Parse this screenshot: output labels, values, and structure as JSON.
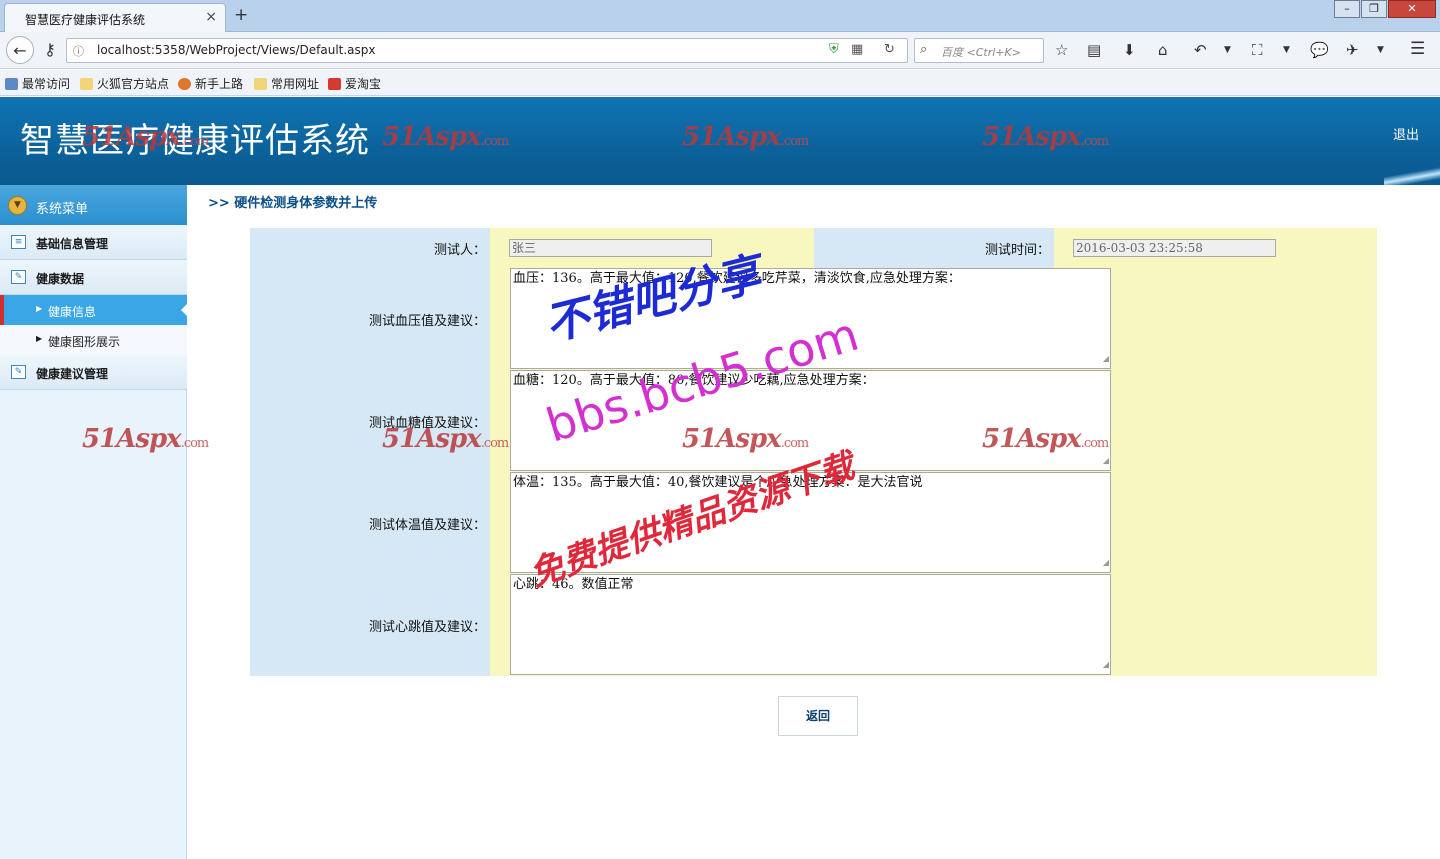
{
  "browser": {
    "tab_title": "智慧医疗健康评估系统",
    "tab_close": "×",
    "new_tab": "+",
    "url": "localhost:5358/WebProject/Views/Default.aspx",
    "search_placeholder": "百度 <Ctrl+K>",
    "bookmarks": [
      "最常访问",
      "火狐官方站点",
      "新手上路",
      "常用网址",
      "爱淘宝"
    ]
  },
  "header": {
    "title": "智慧医疗健康评估系统",
    "logout": "退出"
  },
  "watermark": {
    "brand": "51Aspx",
    "suffix": ".com",
    "forum_line1": "不错吧分享",
    "forum_line2": "bbs.bcb5.com",
    "forum_line3": "免费提供精品资源下载"
  },
  "sidebar": {
    "head": "系统菜单",
    "items": [
      {
        "label": "基础信息管理"
      },
      {
        "label": "健康数据"
      },
      {
        "label": "健康信息"
      },
      {
        "label": "健康图形展示"
      },
      {
        "label": "健康建议管理"
      }
    ]
  },
  "main": {
    "breadcrumb": ">> 硬件检测身体参数并上传",
    "tester_label": "测试人：",
    "tester_value": "张三",
    "time_label": "测试时间：",
    "time_value": "2016-03-03 23:25:58",
    "rows": [
      {
        "label": "测试血压值及建议：",
        "value": "血压：136。高于最大值：120,餐饮建议多吃芹菜，清淡饮食,应急处理方案："
      },
      {
        "label": "测试血糖值及建议：",
        "value": "血糖：120。高于最大值：80,餐饮建议少吃藕,应急处理方案："
      },
      {
        "label": "测试体温值及建议：",
        "value": "体温：135。高于最大值：40,餐饮建议是个应急处理方案：是大法官说"
      },
      {
        "label": "测试心跳值及建议：",
        "value": "心跳：46。数值正常"
      }
    ],
    "back_button": "返回"
  },
  "colors": {
    "header_blue": "#0b5f97",
    "sidebar_active": "#3aa6e6",
    "form_yellow": "#f8f7c0",
    "label_blue": "#d6e8f5"
  }
}
